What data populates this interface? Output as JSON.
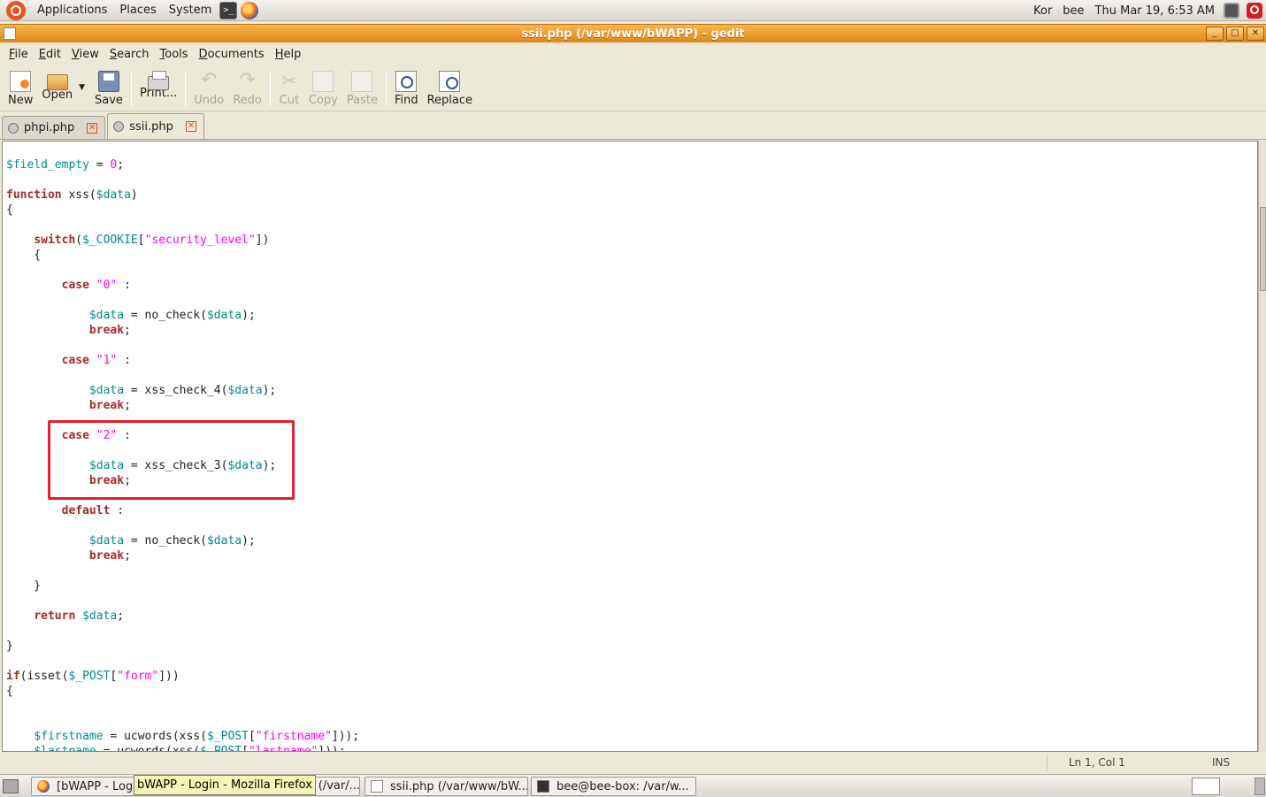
{
  "top_panel": {
    "menus": [
      "Applications",
      "Places",
      "System"
    ],
    "keyboard": "Kor",
    "user": "bee",
    "clock": "Thu Mar 19,  6:53 AM"
  },
  "window": {
    "title": "ssii.php (/var/www/bWAPP) - gedit"
  },
  "menubar": [
    {
      "mnemonic": "F",
      "rest": "ile"
    },
    {
      "mnemonic": "E",
      "rest": "dit"
    },
    {
      "mnemonic": "V",
      "rest": "iew"
    },
    {
      "mnemonic": "S",
      "rest": "earch"
    },
    {
      "mnemonic": "T",
      "rest": "ools"
    },
    {
      "mnemonic": "D",
      "rest": "ocuments"
    },
    {
      "mnemonic": "H",
      "rest": "elp"
    }
  ],
  "toolbar": {
    "new": "New",
    "open": "Open",
    "save": "Save",
    "print": "Print...",
    "undo": "Undo",
    "redo": "Redo",
    "cut": "Cut",
    "copy": "Copy",
    "paste": "Paste",
    "find": "Find",
    "replace": "Replace"
  },
  "tabs": [
    {
      "label": "phpi.php",
      "active": false
    },
    {
      "label": "ssii.php",
      "active": true
    }
  ],
  "code_lines": [
    [
      [
        "var",
        "$field_empty"
      ],
      [
        "plain",
        " = "
      ],
      [
        "str",
        "0"
      ],
      [
        "plain",
        ";"
      ]
    ],
    [],
    [
      [
        "kw",
        "function"
      ],
      [
        "plain",
        " xss("
      ],
      [
        "var",
        "$data"
      ],
      [
        "plain",
        ")"
      ]
    ],
    [
      [
        "plain",
        "{"
      ]
    ],
    [],
    [
      [
        "plain",
        "    "
      ],
      [
        "kw",
        "switch"
      ],
      [
        "plain",
        "("
      ],
      [
        "var",
        "$_COOKIE"
      ],
      [
        "plain",
        "["
      ],
      [
        "str",
        "\"security_level\""
      ],
      [
        "plain",
        "])"
      ]
    ],
    [
      [
        "plain",
        "    {"
      ]
    ],
    [],
    [
      [
        "plain",
        "        "
      ],
      [
        "kw",
        "case"
      ],
      [
        "plain",
        " "
      ],
      [
        "str",
        "\"0\""
      ],
      [
        "plain",
        " :"
      ]
    ],
    [],
    [
      [
        "plain",
        "            "
      ],
      [
        "var",
        "$data"
      ],
      [
        "plain",
        " = no_check("
      ],
      [
        "var",
        "$data"
      ],
      [
        "plain",
        ");"
      ]
    ],
    [
      [
        "plain",
        "            "
      ],
      [
        "kw",
        "break"
      ],
      [
        "plain",
        ";"
      ]
    ],
    [],
    [
      [
        "plain",
        "        "
      ],
      [
        "kw",
        "case"
      ],
      [
        "plain",
        " "
      ],
      [
        "str",
        "\"1\""
      ],
      [
        "plain",
        " :"
      ]
    ],
    [],
    [
      [
        "plain",
        "            "
      ],
      [
        "var",
        "$data"
      ],
      [
        "plain",
        " = xss_check_4("
      ],
      [
        "var",
        "$data"
      ],
      [
        "plain",
        ");"
      ]
    ],
    [
      [
        "plain",
        "            "
      ],
      [
        "kw",
        "break"
      ],
      [
        "plain",
        ";"
      ]
    ],
    [],
    [
      [
        "plain",
        "        "
      ],
      [
        "kw",
        "case"
      ],
      [
        "plain",
        " "
      ],
      [
        "str",
        "\"2\""
      ],
      [
        "plain",
        " :"
      ]
    ],
    [],
    [
      [
        "plain",
        "            "
      ],
      [
        "var",
        "$data"
      ],
      [
        "plain",
        " = xss_check_3("
      ],
      [
        "var",
        "$data"
      ],
      [
        "plain",
        ");"
      ]
    ],
    [
      [
        "plain",
        "            "
      ],
      [
        "kw",
        "break"
      ],
      [
        "plain",
        ";"
      ]
    ],
    [],
    [
      [
        "plain",
        "        "
      ],
      [
        "kw",
        "default"
      ],
      [
        "plain",
        " :"
      ]
    ],
    [],
    [
      [
        "plain",
        "            "
      ],
      [
        "var",
        "$data"
      ],
      [
        "plain",
        " = no_check("
      ],
      [
        "var",
        "$data"
      ],
      [
        "plain",
        ");"
      ]
    ],
    [
      [
        "plain",
        "            "
      ],
      [
        "kw",
        "break"
      ],
      [
        "plain",
        ";"
      ]
    ],
    [],
    [
      [
        "plain",
        "    }"
      ]
    ],
    [],
    [
      [
        "plain",
        "    "
      ],
      [
        "kw",
        "return"
      ],
      [
        "plain",
        " "
      ],
      [
        "var",
        "$data"
      ],
      [
        "plain",
        ";"
      ]
    ],
    [],
    [
      [
        "plain",
        "}"
      ]
    ],
    [],
    [
      [
        "kw",
        "if"
      ],
      [
        "plain",
        "(isset("
      ],
      [
        "var",
        "$_POST"
      ],
      [
        "plain",
        "["
      ],
      [
        "str",
        "\"form\""
      ],
      [
        "plain",
        "]))"
      ]
    ],
    [
      [
        "plain",
        "{"
      ]
    ],
    [],
    [],
    [
      [
        "plain",
        "    "
      ],
      [
        "var",
        "$firstname"
      ],
      [
        "plain",
        " = ucwords(xss("
      ],
      [
        "var",
        "$_POST"
      ],
      [
        "plain",
        "["
      ],
      [
        "str",
        "\"firstname\""
      ],
      [
        "plain",
        "]));"
      ]
    ],
    [
      [
        "plain",
        "    "
      ],
      [
        "var",
        "$lastname"
      ],
      [
        "plain",
        " = ucwords(xss("
      ],
      [
        "var",
        "$_POST"
      ],
      [
        "plain",
        "["
      ],
      [
        "str",
        "\"lastname\""
      ],
      [
        "plain",
        "]));"
      ]
    ]
  ],
  "statusbar": {
    "position": "Ln 1, Col 1",
    "mode": "INS"
  },
  "taskbar": {
    "tasks": [
      {
        "label": "[bWAPP - Login - Mozilla Firefox]",
        "icon": "firefox-icon"
      },
      {
        "label": "[*phpi.php (/var/...",
        "icon": "gedit-icon"
      },
      {
        "label": "ssii.php (/var/www/bW...",
        "icon": "gedit-icon"
      },
      {
        "label": "bee@bee-box: /var/w...",
        "icon": "terminal-icon"
      }
    ],
    "tooltip": "bWAPP - Login - Mozilla Firefox"
  },
  "colors": {
    "keyword": "#a52a2a",
    "variable": "#008a8c",
    "string": "#ff00ff",
    "highlight_box": "#e3202f",
    "titlebar": "#e99a2c"
  }
}
